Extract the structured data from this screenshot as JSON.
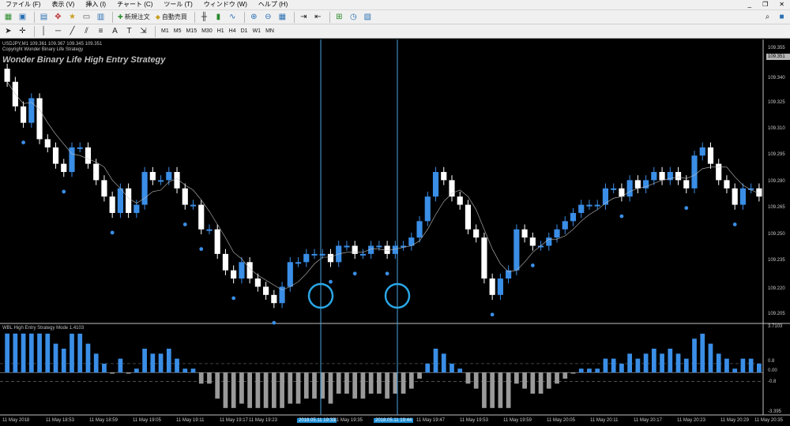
{
  "menu": {
    "items": [
      "ファイル (F)",
      "表示 (V)",
      "挿入 (I)",
      "チャート (C)",
      "ツール (T)",
      "ウィンドウ (W)",
      "ヘルプ (H)"
    ]
  },
  "toolbar": {
    "new_order": "新規注文",
    "auto_trade": "自動売買",
    "timeframes": [
      "M1",
      "M5",
      "M15",
      "M30",
      "H1",
      "H4",
      "D1",
      "W1",
      "MN"
    ],
    "text_tool": "A",
    "label_tool": "T"
  },
  "chart": {
    "symbol_line": "USDJPY,M1  109.361 109.367 109.345 109.351",
    "copyright": "Copyright Wonder Binary Life Strategy",
    "strategy_title": "Wonder Binary Life High Entry Strategy",
    "current_price": "109.351",
    "price_labels": [
      "109.355",
      "109.340",
      "109.325",
      "109.310",
      "109.295",
      "109.280",
      "109.265",
      "109.250",
      "109.235",
      "109.220",
      "109.205"
    ],
    "indicator_title": "WBL High Entry Strategy Mode 1.4103",
    "indicator_labels": [
      "3.7103",
      "0.8",
      "0.00",
      "-0.8",
      "-3.395"
    ],
    "time_labels": [
      "11 May 2018",
      "11 May 18:53",
      "11 May 18:59",
      "11 May 19:05",
      "11 May 19:11",
      "11 May 19:17",
      "11 May 19:23",
      "2018.05.11 19:33",
      "11 May 19:35",
      "2018.05.11 19:44",
      "11 May 19:47",
      "11 May 19:53",
      "11 May 19:59",
      "11 May 20:05",
      "11 May 20:11",
      "11 May 20:17",
      "11 May 20:23",
      "11 May 20:29",
      "11 May 20:35"
    ],
    "colors": {
      "bull": "#3a8ee6",
      "bear": "#ffffff",
      "indicator_pos": "#3a8ee6",
      "indicator_neg": "#9a9a9a",
      "crosshair": "#4aa3e0",
      "circle": "#2aa7e6"
    }
  },
  "chart_data": {
    "type": "candlestick",
    "symbol": "USDJPY,M1",
    "ylim": [
      109.195,
      109.362
    ],
    "closes": [
      109.34,
      109.325,
      109.315,
      109.33,
      109.305,
      109.3,
      109.29,
      109.285,
      109.3,
      109.3,
      109.29,
      109.28,
      109.27,
      109.26,
      109.275,
      109.26,
      109.265,
      109.285,
      109.28,
      109.28,
      109.285,
      109.275,
      109.265,
      109.265,
      109.25,
      109.25,
      109.235,
      109.225,
      109.22,
      109.23,
      109.22,
      109.215,
      109.21,
      109.205,
      109.215,
      109.23,
      109.23,
      109.235,
      109.235,
      109.235,
      109.23,
      109.24,
      109.24,
      109.235,
      109.235,
      109.24,
      109.24,
      109.235,
      109.24,
      109.24,
      109.245,
      109.255,
      109.27,
      109.285,
      109.28,
      109.27,
      109.265,
      109.25,
      109.245,
      109.22,
      109.21,
      109.22,
      109.225,
      109.25,
      109.245,
      109.24,
      109.24,
      109.245,
      109.25,
      109.255,
      109.26,
      109.265,
      109.265,
      109.265,
      109.275,
      109.275,
      109.27,
      109.28,
      109.275,
      109.28,
      109.285,
      109.28,
      109.285,
      109.28,
      109.275,
      109.295,
      109.3,
      109.29,
      109.28,
      109.275,
      109.265,
      109.275,
      109.275,
      109.27
    ],
    "indicator": {
      "name": "WBL High Entry Strategy Mode 1.4103",
      "ylim": [
        -3.395,
        3.7103
      ],
      "levels": [
        0.8,
        0,
        -0.8
      ]
    }
  }
}
